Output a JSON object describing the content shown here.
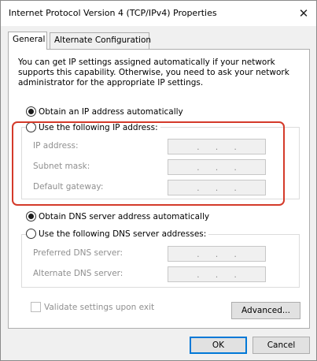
{
  "window": {
    "title": "Internet Protocol Version 4 (TCP/IPv4) Properties",
    "close_glyph": "✕"
  },
  "tabs": [
    {
      "label": "General",
      "active": true
    },
    {
      "label": "Alternate Configuration",
      "active": false
    }
  ],
  "info_text": "You can get IP settings assigned automatically if your network supports this capability. Otherwise, you need to ask your network administrator for the appropriate IP settings.",
  "ip_section": {
    "auto_label": "Obtain an IP address automatically",
    "auto_checked": true,
    "manual_label": "Use the following IP address:",
    "manual_checked": false,
    "fields": [
      {
        "label": "IP address:",
        "dots": [
          ".",
          ".",
          "."
        ]
      },
      {
        "label": "Subnet mask:",
        "dots": [
          ".",
          ".",
          "."
        ]
      },
      {
        "label": "Default gateway:",
        "dots": [
          ".",
          ".",
          "."
        ]
      }
    ]
  },
  "dns_section": {
    "auto_label": "Obtain DNS server address automatically",
    "auto_checked": true,
    "manual_label": "Use the following DNS server addresses:",
    "manual_checked": false,
    "fields": [
      {
        "label": "Preferred DNS server:",
        "dots": [
          ".",
          ".",
          "."
        ]
      },
      {
        "label": "Alternate DNS server:",
        "dots": [
          ".",
          ".",
          "."
        ]
      }
    ]
  },
  "validate_label": "Validate settings upon exit",
  "validate_checked": false,
  "buttons": {
    "advanced": "Advanced...",
    "ok": "OK",
    "cancel": "Cancel"
  },
  "colors": {
    "highlight": "#d43a2a",
    "focus": "#0078d7"
  }
}
